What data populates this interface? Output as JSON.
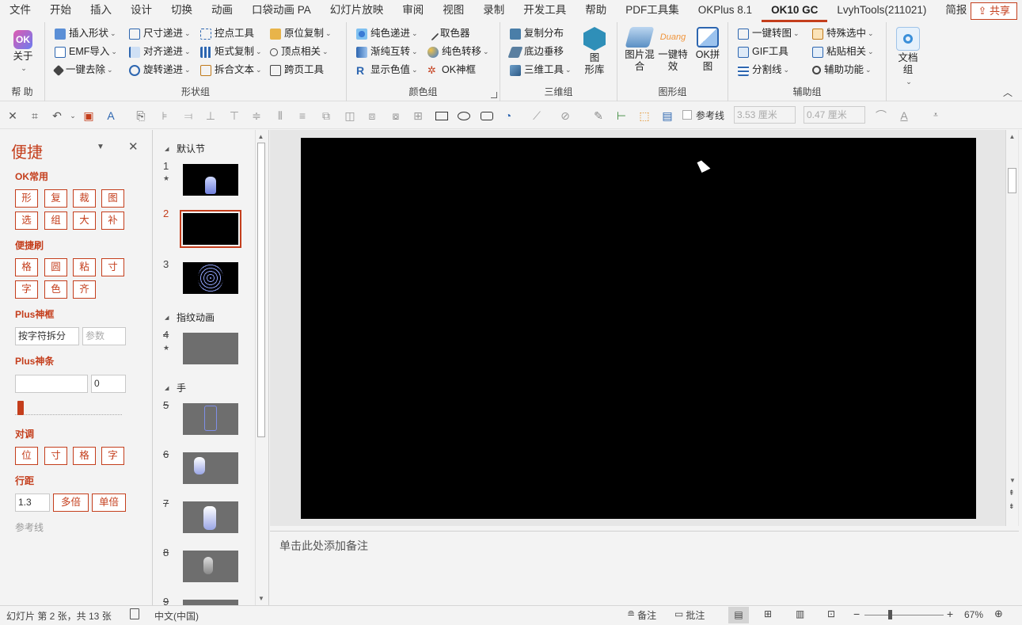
{
  "menu": {
    "tabs": [
      "文件",
      "开始",
      "插入",
      "设计",
      "切换",
      "动画",
      "口袋动画 PA",
      "幻灯片放映",
      "审阅",
      "视图",
      "录制",
      "开发工具",
      "帮助",
      "PDF工具集",
      "OKPlus 8.1",
      "OK10 GC",
      "LvyhTools(211021)",
      "简报"
    ],
    "active": "OK10 GC",
    "share": "共享"
  },
  "ribbon": {
    "help_group": {
      "about": "关于",
      "label": "帮 助"
    },
    "shape_group": {
      "label": "形状组",
      "col1": [
        "插入形状",
        "EMF导入",
        "一键去除"
      ],
      "col2": [
        "尺寸递进",
        "对齐递进",
        "旋转递进"
      ],
      "col3": [
        "控点工具",
        "矩式复制",
        "拆合文本"
      ],
      "col4": [
        "原位复制",
        "顶点相关",
        "跨页工具"
      ]
    },
    "color_group": {
      "label": "颜色组",
      "col1": [
        "纯色递进",
        "渐纯互转",
        "显示色值"
      ],
      "col2": [
        "取色器",
        "纯色转移",
        "OK神框"
      ]
    },
    "three_d_group": {
      "label": "三维组",
      "items": [
        "复制分布",
        "底边垂移",
        "三维工具"
      ],
      "gallery": "图\n形库"
    },
    "graphic_group": {
      "label": "图形组",
      "buttons": [
        "图片混\n合",
        "一键特\n效",
        "OK拼\n图"
      ],
      "duang": "Duang"
    },
    "aux_group": {
      "label": "辅助组",
      "col1": [
        "一键转图",
        "GIF工具",
        "分割线"
      ],
      "col2": [
        "特殊选中",
        "粘贴相关",
        "辅助功能"
      ]
    },
    "doc_group": {
      "label": "文档\n组"
    }
  },
  "qat": {
    "ref_line": "参考线",
    "width_value": "3.53 厘米",
    "height_value": "0.47 厘米"
  },
  "pane": {
    "title": "便捷",
    "sections": {
      "ok_common": {
        "label": "OK常用",
        "row1": [
          "形",
          "复",
          "裁",
          "图"
        ],
        "row2": [
          "选",
          "组",
          "大",
          "补"
        ]
      },
      "brush": {
        "label": "便捷刷",
        "row1": [
          "格",
          "圆",
          "粘",
          "寸"
        ],
        "row2": [
          "字",
          "色",
          "齐"
        ]
      },
      "plus_frame": {
        "label": "Plus神框",
        "input": "按字符拆分",
        "param_placeholder": "参数"
      },
      "plus_bar": {
        "label": "Plus神条",
        "value": "0"
      },
      "adjust": {
        "label": "对调",
        "buttons": [
          "位",
          "寸",
          "格",
          "字"
        ]
      },
      "spacing": {
        "label": "行距",
        "value": "1.3",
        "multi": "多倍",
        "single": "单倍"
      },
      "refline": {
        "label": "参考线"
      }
    }
  },
  "thumbnails": {
    "sections": [
      "默认节",
      "指纹动画",
      "手"
    ],
    "slides": [
      "1",
      "2",
      "3",
      "4",
      "5",
      "6",
      "7",
      "8",
      "9"
    ]
  },
  "notes": {
    "placeholder": "单击此处添加备注"
  },
  "status": {
    "slide_info": "幻灯片 第 2 张，共 13 张",
    "language": "中文(中国)",
    "notes": "备注",
    "comments": "批注",
    "zoom": "67%"
  },
  "colors": {
    "accent": "#c43e1c",
    "slide_bg": "#000000"
  }
}
